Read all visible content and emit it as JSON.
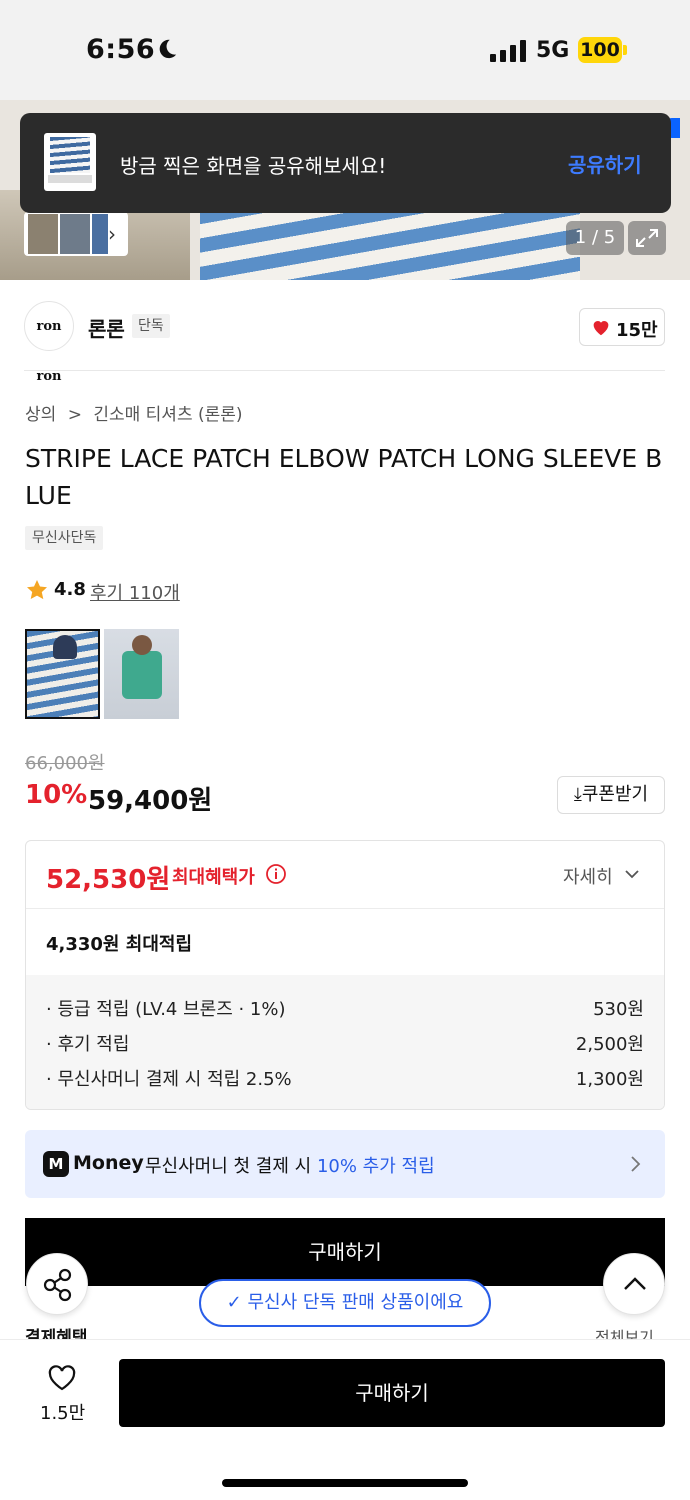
{
  "status": {
    "time": "6:56",
    "network": "5G",
    "battery": "100"
  },
  "hero": {
    "counter": "1 / 5"
  },
  "toast": {
    "message": "방금 찍은 화면을 공유해보세요!",
    "action": "공유하기"
  },
  "brand": {
    "logo_text": "ron ron",
    "name": "론론",
    "tag": "단독",
    "likes": "15만"
  },
  "breadcrumb": {
    "category": "상의",
    "separator": ">",
    "subcategory": "긴소매 티셔츠 (론론)"
  },
  "product": {
    "title": "STRIPE LACE PATCH ELBOW PATCH LONG SLEEVE BLUE",
    "exclusive_badge": "무신사단독",
    "rating": "4.8",
    "reviews": "후기 110개",
    "original_price": "66,000원",
    "discount": "10%",
    "price": "59,400원",
    "coupon_label": "쿠폰받기"
  },
  "benefit": {
    "max_price": "52,530원",
    "max_label": "최대혜택가",
    "more": "자세히",
    "points_total": "4,330원 최대적립",
    "rows": [
      {
        "label": "· 등급 적립 (LV.4 브론즈 · 1%)",
        "value": "530원"
      },
      {
        "label": "· 후기 적립",
        "value": "2,500원"
      },
      {
        "label": "· 무신사머니 결제 시 적립 2.5%",
        "value": "1,300원"
      }
    ]
  },
  "money": {
    "logo": "M",
    "brand": "Money",
    "text": "무신사머니 첫 결제 시",
    "highlight": "10% 추가 적립"
  },
  "actions": {
    "buy_top": "구매하기",
    "exclusive_pill": "무신사 단독 판매 상품이에요",
    "section_left": "결제혜택",
    "section_right": "전체보기",
    "wish_count": "1.5만",
    "buy": "구매하기"
  },
  "colors": {
    "sale_red": "#e4222d",
    "accent_blue": "#2a5ee8",
    "battery_yellow": "#ffd60a"
  }
}
